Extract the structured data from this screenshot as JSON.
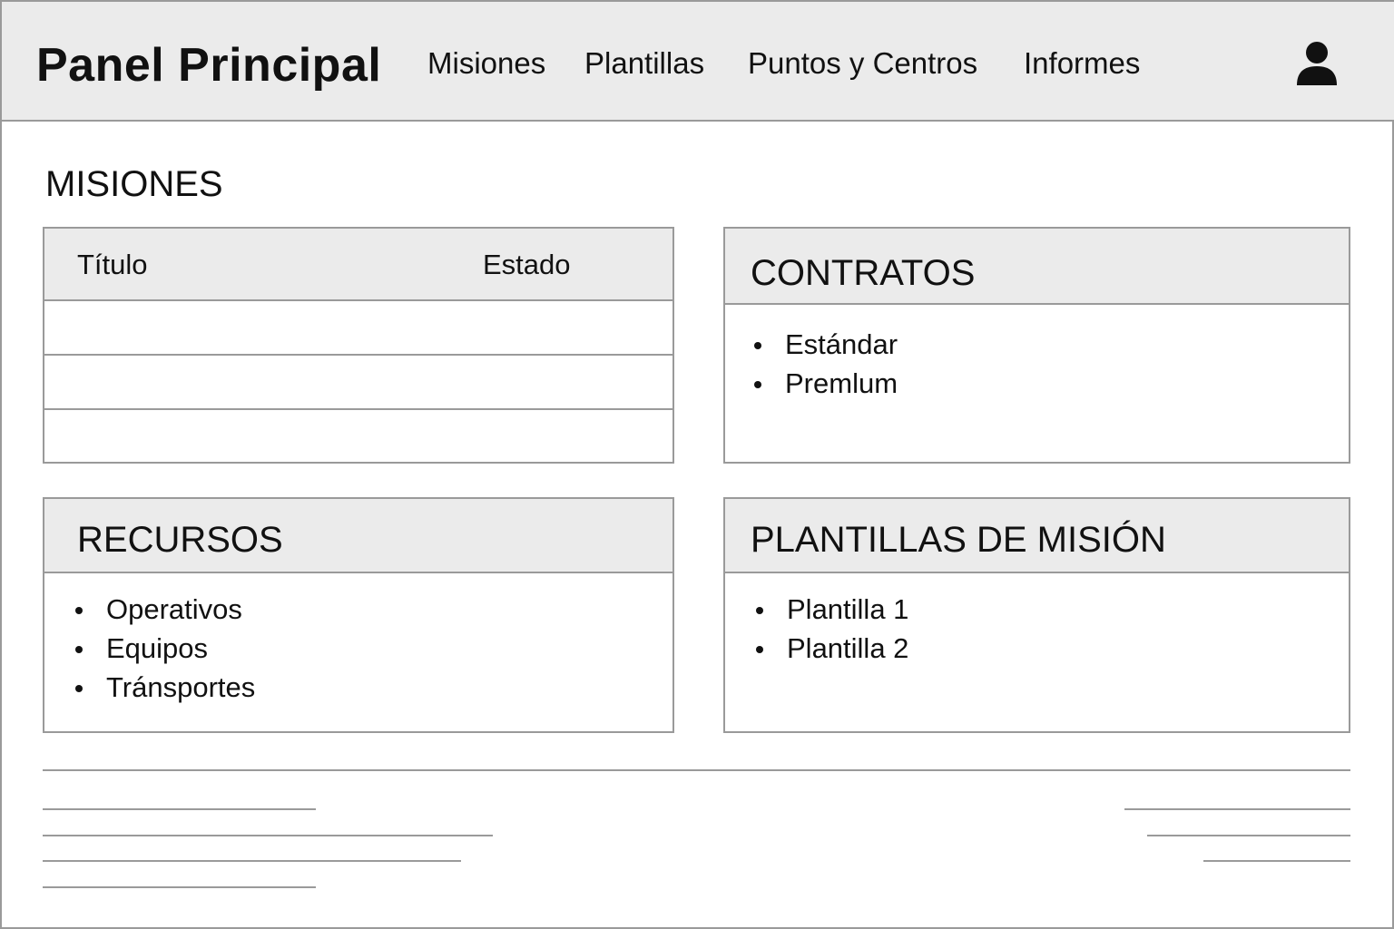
{
  "header": {
    "title": "Panel Principal",
    "nav": [
      "Misiones",
      "Plantillas",
      "Puntos y Centros",
      "Informes"
    ],
    "user_icon": "user-icon"
  },
  "missions": {
    "section_title": "MISIONES",
    "columns": [
      "Título",
      "Estado"
    ],
    "rows": [
      {
        "title": "",
        "status": ""
      },
      {
        "title": "",
        "status": ""
      },
      {
        "title": "",
        "status": ""
      }
    ]
  },
  "contracts": {
    "title": "CONTRATOS",
    "items": [
      "Estándar",
      "Premlum"
    ]
  },
  "resources": {
    "title": "RECURSOS",
    "items": [
      "Operativos",
      "Equipos",
      "Tránsportes"
    ]
  },
  "templates": {
    "title": "PLANTILLAS DE MISIÓN",
    "items": [
      "Plantilla 1",
      "Plantilla 2"
    ]
  },
  "colors": {
    "header_bg": "#ebebeb",
    "border": "#9a9a9a",
    "text": "#111111"
  }
}
